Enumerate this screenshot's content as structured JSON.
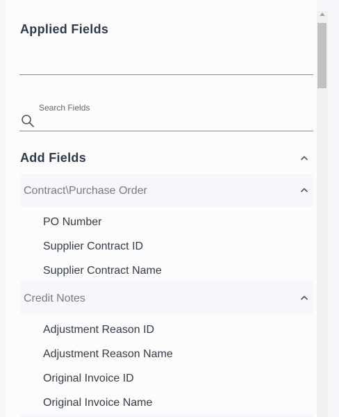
{
  "applied": {
    "title": "Applied Fields"
  },
  "search": {
    "label": "Search Fields",
    "value": "",
    "placeholder": ""
  },
  "add": {
    "title": "Add Fields"
  },
  "groups": [
    {
      "label": "Contract\\Purchase Order",
      "items": [
        "PO Number",
        "Supplier Contract ID",
        "Supplier Contract Name"
      ]
    },
    {
      "label": "Credit Notes",
      "items": [
        "Adjustment Reason ID",
        "Adjustment Reason Name",
        "Original Invoice ID",
        "Original Invoice Name"
      ]
    }
  ],
  "icons": {
    "search": "search-icon",
    "collapse": "chevron-up-icon",
    "scroll_up": "arrow-up-icon"
  },
  "colors": {
    "heading": "#2c3a4b",
    "group_bg": "#f7f6fb",
    "group_text": "#7b7b7b",
    "item_text": "#333d47"
  }
}
